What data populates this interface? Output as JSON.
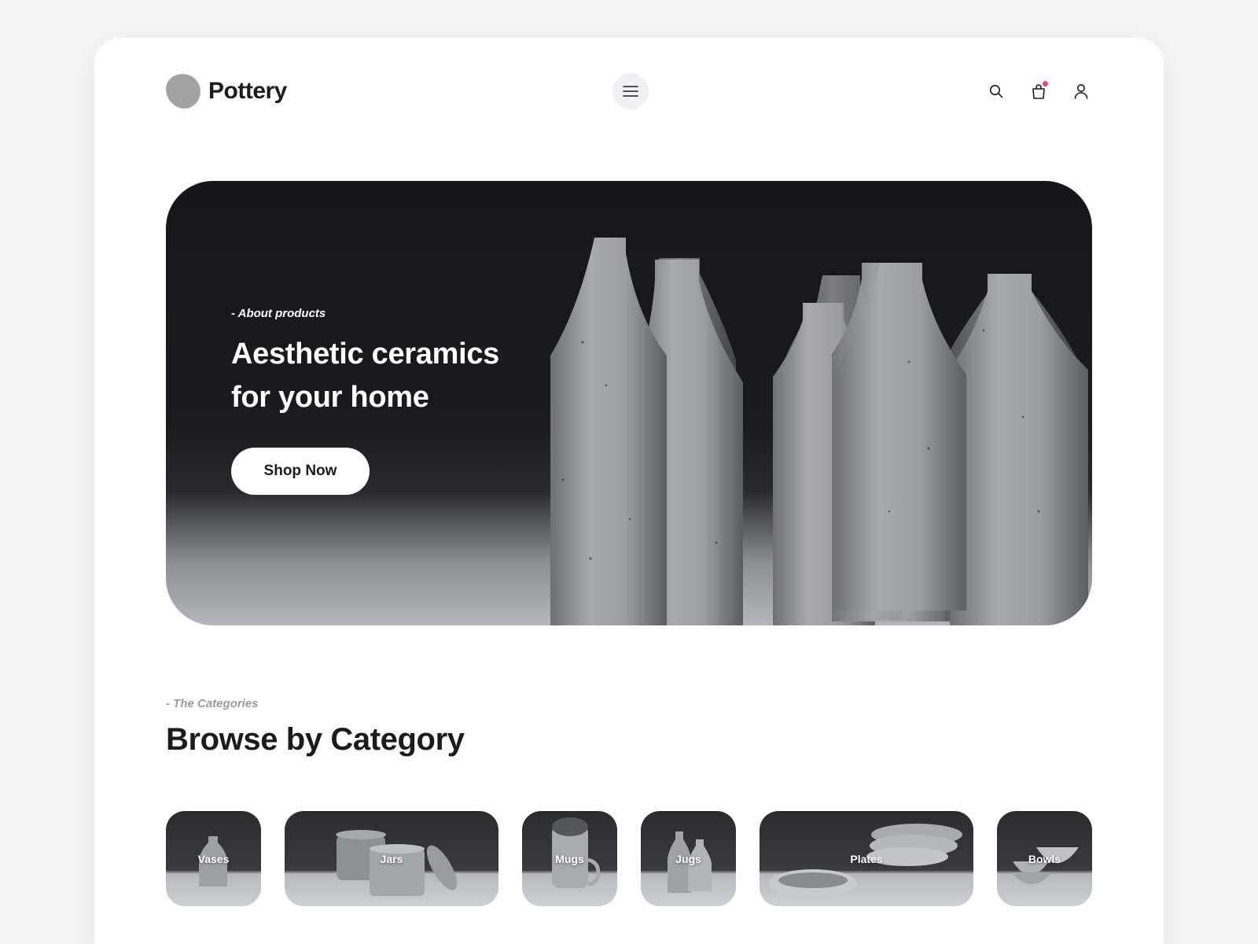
{
  "header": {
    "logo_text": "Pottery",
    "menu_icon": "hamburger-icon",
    "icons": [
      "search-icon",
      "bag-icon",
      "user-icon"
    ],
    "cart_badge_color": "#e8447a"
  },
  "hero": {
    "eyebrow": "- About products",
    "title": "Aesthetic ceramics for your home",
    "cta_label": "Shop Now"
  },
  "categories": {
    "eyebrow": "- The Categories",
    "title": "Browse by Category",
    "items": [
      {
        "label": "Vases"
      },
      {
        "label": "Jars"
      },
      {
        "label": "Mugs"
      },
      {
        "label": "Jugs"
      },
      {
        "label": "Plates"
      },
      {
        "label": "Bowls"
      }
    ]
  },
  "colors": {
    "text_primary": "#1c1c1e",
    "text_muted": "#9a9a9e",
    "logo_gray": "#a3a3a3",
    "menu_bg": "#f1f1f4"
  }
}
